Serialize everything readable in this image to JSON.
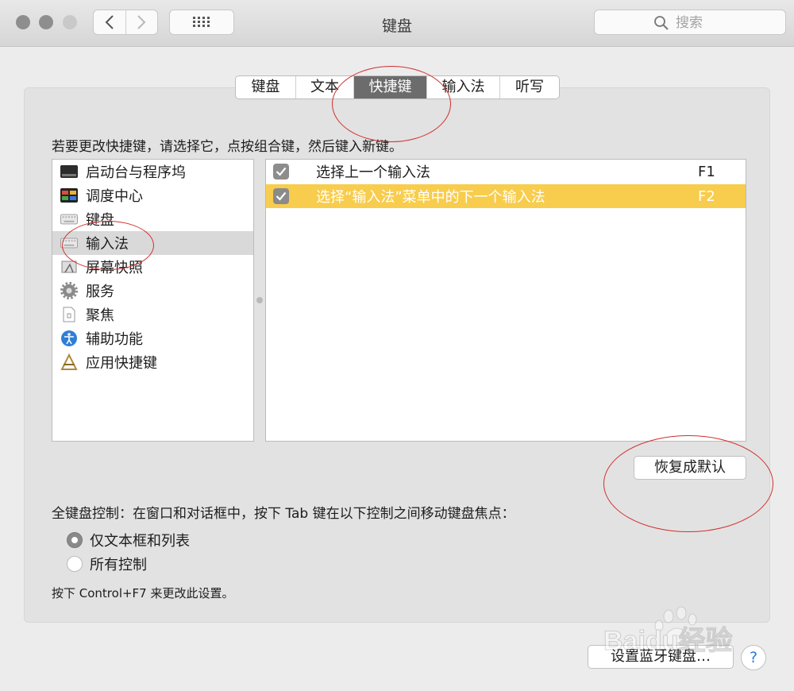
{
  "window": {
    "title": "键盘"
  },
  "search": {
    "placeholder": "搜索"
  },
  "tabs": [
    {
      "label": "键盘",
      "active": false
    },
    {
      "label": "文本",
      "active": false
    },
    {
      "label": "快捷键",
      "active": true
    },
    {
      "label": "输入法",
      "active": false
    },
    {
      "label": "听写",
      "active": false
    }
  ],
  "instruction": "若要更改快捷键，请选择它，点按组合键，然后键入新键。",
  "categories": [
    {
      "label": "启动台与程序坞",
      "icon": "launchpad-dock-icon"
    },
    {
      "label": "调度中心",
      "icon": "mission-control-icon"
    },
    {
      "label": "键盘",
      "icon": "keyboard-icon"
    },
    {
      "label": "输入法",
      "icon": "input-source-icon",
      "selected": true
    },
    {
      "label": "屏幕快照",
      "icon": "screenshot-icon"
    },
    {
      "label": "服务",
      "icon": "gear-icon"
    },
    {
      "label": "聚焦",
      "icon": "spotlight-icon"
    },
    {
      "label": "辅助功能",
      "icon": "accessibility-icon"
    },
    {
      "label": "应用快捷键",
      "icon": "app-shortcuts-icon"
    }
  ],
  "shortcuts": [
    {
      "label": "选择上一个输入法",
      "key": "F1",
      "checked": true,
      "selected": false
    },
    {
      "label": "选择“输入法”菜单中的下一个输入法",
      "key": "F2",
      "checked": true,
      "selected": true
    }
  ],
  "buttons": {
    "restore_defaults": "恢复成默认",
    "bluetooth_keyboard": "设置蓝牙键盘…",
    "help": "?"
  },
  "full_keyboard_access": {
    "label": "全键盘控制：在窗口和对话框中，按下 Tab 键在以下控制之间移动键盘焦点：",
    "options": [
      {
        "label": "仅文本框和列表",
        "selected": true
      },
      {
        "label": "所有控制",
        "selected": false
      }
    ],
    "hint": "按下 Control+F7 来更改此设置。"
  },
  "colors": {
    "selection": "#f8cc4c",
    "annotation": "#d0302e",
    "active_tab": "#6c6c6c"
  },
  "watermark": {
    "text": "Baidu经验"
  }
}
